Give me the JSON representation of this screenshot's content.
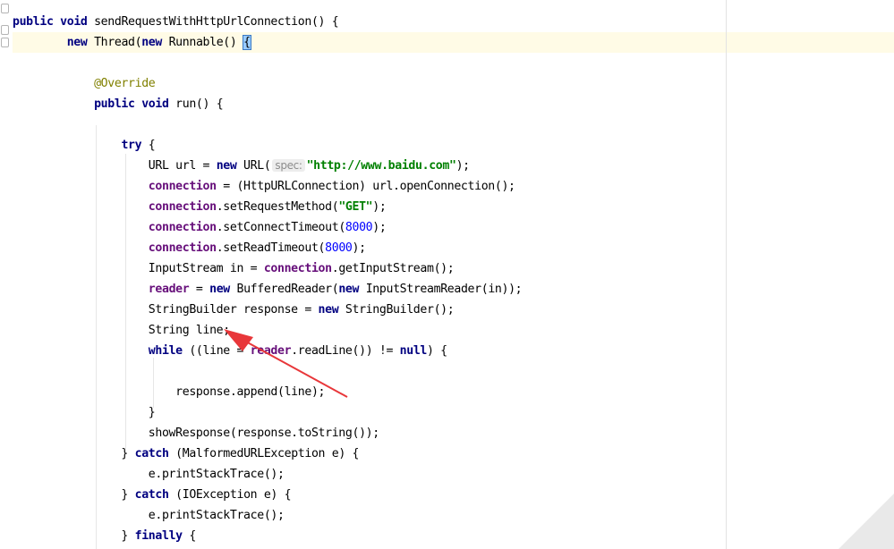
{
  "editor": {
    "lines": [
      {
        "t": "    ",
        "s": [
          {
            "k": "kw",
            "v": "public"
          },
          {
            "v": " "
          },
          {
            "k": "kw",
            "v": "void"
          },
          {
            "v": " sendRequestWithHttpUrlConnection() {"
          }
        ]
      },
      {
        "s": [
          {
            "v": "        "
          },
          {
            "k": "kw",
            "v": "new"
          },
          {
            "v": " Thread("
          },
          {
            "k": "kw",
            "v": "new"
          },
          {
            "v": " Runnable() "
          },
          {
            "k": "brace",
            "v": "{"
          }
        ]
      },
      {
        "s": []
      },
      {
        "s": [
          {
            "v": "            "
          },
          {
            "k": "ann",
            "v": "@Override"
          }
        ]
      },
      {
        "s": [
          {
            "v": "            "
          },
          {
            "k": "kw",
            "v": "public"
          },
          {
            "v": " "
          },
          {
            "k": "kw",
            "v": "void"
          },
          {
            "v": " run() {"
          }
        ]
      },
      {
        "s": []
      },
      {
        "s": [
          {
            "v": "                "
          },
          {
            "k": "kw",
            "v": "try"
          },
          {
            "v": " {"
          }
        ]
      },
      {
        "s": [
          {
            "v": "                    URL url = "
          },
          {
            "k": "kw",
            "v": "new"
          },
          {
            "v": " URL("
          },
          {
            "k": "hint",
            "v": "spec:"
          },
          {
            "k": "str",
            "v": "\"http://www.baidu.com\""
          },
          {
            "v": ");"
          }
        ]
      },
      {
        "s": [
          {
            "v": "                    "
          },
          {
            "k": "fld",
            "v": "connection"
          },
          {
            "v": " = (HttpURLConnection) url.openConnection();"
          }
        ]
      },
      {
        "s": [
          {
            "v": "                    "
          },
          {
            "k": "fld",
            "v": "connection"
          },
          {
            "v": ".setRequestMethod("
          },
          {
            "k": "str",
            "v": "\"GET\""
          },
          {
            "v": ");"
          }
        ]
      },
      {
        "s": [
          {
            "v": "                    "
          },
          {
            "k": "fld",
            "v": "connection"
          },
          {
            "v": ".setConnectTimeout("
          },
          {
            "k": "num",
            "v": "8000"
          },
          {
            "v": ");"
          }
        ]
      },
      {
        "s": [
          {
            "v": "                    "
          },
          {
            "k": "fld",
            "v": "connection"
          },
          {
            "v": ".setReadTimeout("
          },
          {
            "k": "num",
            "v": "8000"
          },
          {
            "v": ");"
          }
        ]
      },
      {
        "s": [
          {
            "v": "                    InputStream in = "
          },
          {
            "k": "fld",
            "v": "connection"
          },
          {
            "v": ".getInputStream();"
          }
        ]
      },
      {
        "s": [
          {
            "v": "                    "
          },
          {
            "k": "fld",
            "v": "reader"
          },
          {
            "v": " = "
          },
          {
            "k": "kw",
            "v": "new"
          },
          {
            "v": " BufferedReader("
          },
          {
            "k": "kw",
            "v": "new"
          },
          {
            "v": " InputStreamReader(in));"
          }
        ]
      },
      {
        "s": [
          {
            "v": "                    StringBuilder response = "
          },
          {
            "k": "kw",
            "v": "new"
          },
          {
            "v": " StringBuilder();"
          }
        ]
      },
      {
        "s": [
          {
            "v": "                    String line;"
          }
        ]
      },
      {
        "s": [
          {
            "v": "                    "
          },
          {
            "k": "kw",
            "v": "while"
          },
          {
            "v": " ((line = "
          },
          {
            "k": "fld",
            "v": "reader"
          },
          {
            "v": ".readLine()) != "
          },
          {
            "k": "kw",
            "v": "null"
          },
          {
            "v": ") {"
          }
        ]
      },
      {
        "s": []
      },
      {
        "s": [
          {
            "v": "                        response.append(line);"
          }
        ]
      },
      {
        "s": [
          {
            "v": "                    }"
          }
        ]
      },
      {
        "s": [
          {
            "v": "                    showResponse(response.toString());"
          }
        ]
      },
      {
        "s": [
          {
            "v": "                } "
          },
          {
            "k": "kw",
            "v": "catch"
          },
          {
            "v": " (MalformedURLException e) {"
          }
        ]
      },
      {
        "s": [
          {
            "v": "                    e.printStackTrace();"
          }
        ]
      },
      {
        "s": [
          {
            "v": "                } "
          },
          {
            "k": "kw",
            "v": "catch"
          },
          {
            "v": " (IOException e) {"
          }
        ]
      },
      {
        "s": [
          {
            "v": "                    e.printStackTrace();"
          }
        ]
      },
      {
        "s": [
          {
            "v": "                } "
          },
          {
            "k": "kw",
            "v": "finally"
          },
          {
            "v": " {"
          }
        ]
      }
    ]
  },
  "colors": {
    "keyword": "#000080",
    "field": "#660e7a",
    "string": "#008000",
    "number": "#0000ff",
    "annotation": "#808000",
    "caret_row": "#fffbe6",
    "annotation_arrow": "#e8373a"
  },
  "icons": [
    "fold-marker-icon",
    "annotation-arrow"
  ]
}
